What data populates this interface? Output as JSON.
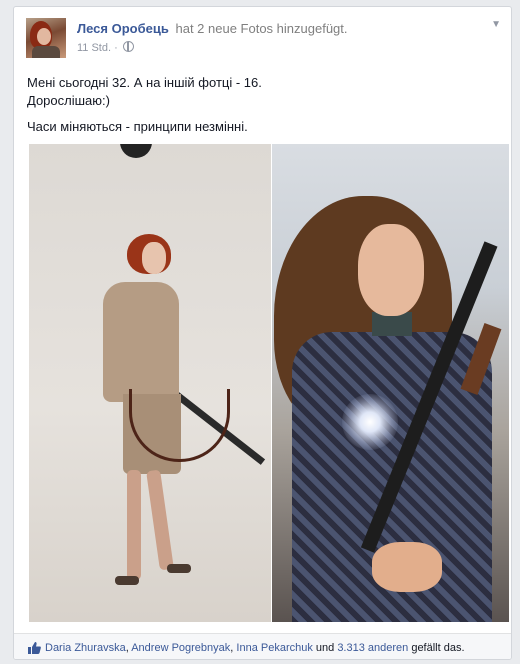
{
  "post": {
    "author": "Леся Оробець",
    "action": "hat 2 neue Fotos hinzugefügt.",
    "time": "11 Std.",
    "text_line1": "Мені сьогодні 32. А на іншій фотці - 16.",
    "text_line2": "Дорослішаю:)",
    "text_line3": "Часи міняються - принципи незмінні."
  },
  "likes": {
    "names": [
      "Daria Zhuravska",
      "Andrew Pogrebnyak",
      "Inna Pekarchuk"
    ],
    "sep1": ", ",
    "sep2": ", ",
    "sep3": ", ",
    "others_count": "3.313 anderen",
    "conj": " und ",
    "tail": " gefällt das."
  },
  "colors": {
    "link": "#3b5998",
    "meta": "#9197a3",
    "background": "#e9ebee"
  },
  "icons": [
    "globe-icon",
    "chevron-down-icon",
    "thumbs-up-icon"
  ]
}
